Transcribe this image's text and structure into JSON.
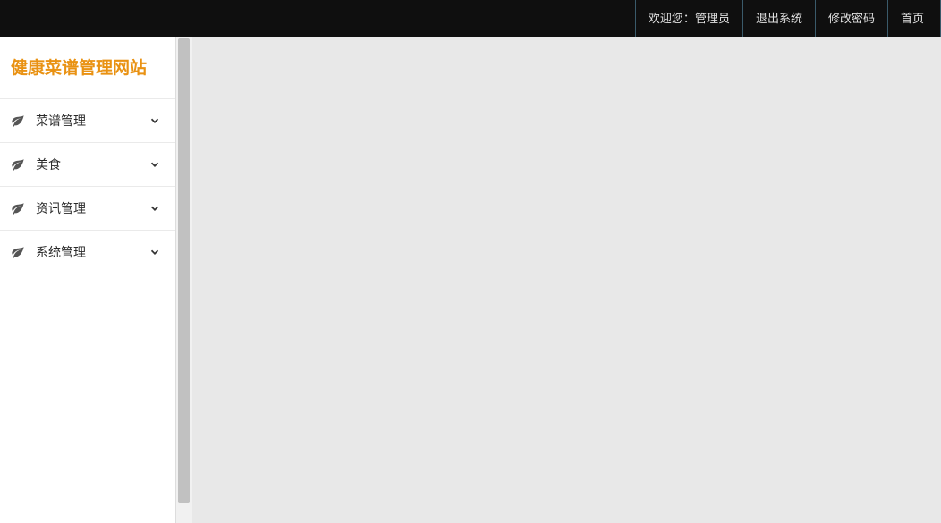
{
  "header": {
    "welcome_prefix": "欢迎您：",
    "welcome_user": "管理员",
    "logout": "退出系统",
    "change_password": "修改密码",
    "home": "首页"
  },
  "sidebar": {
    "title": "健康菜谱管理网站",
    "items": [
      {
        "label": "菜谱管理"
      },
      {
        "label": "美食"
      },
      {
        "label": "资讯管理"
      },
      {
        "label": "系统管理"
      }
    ]
  }
}
